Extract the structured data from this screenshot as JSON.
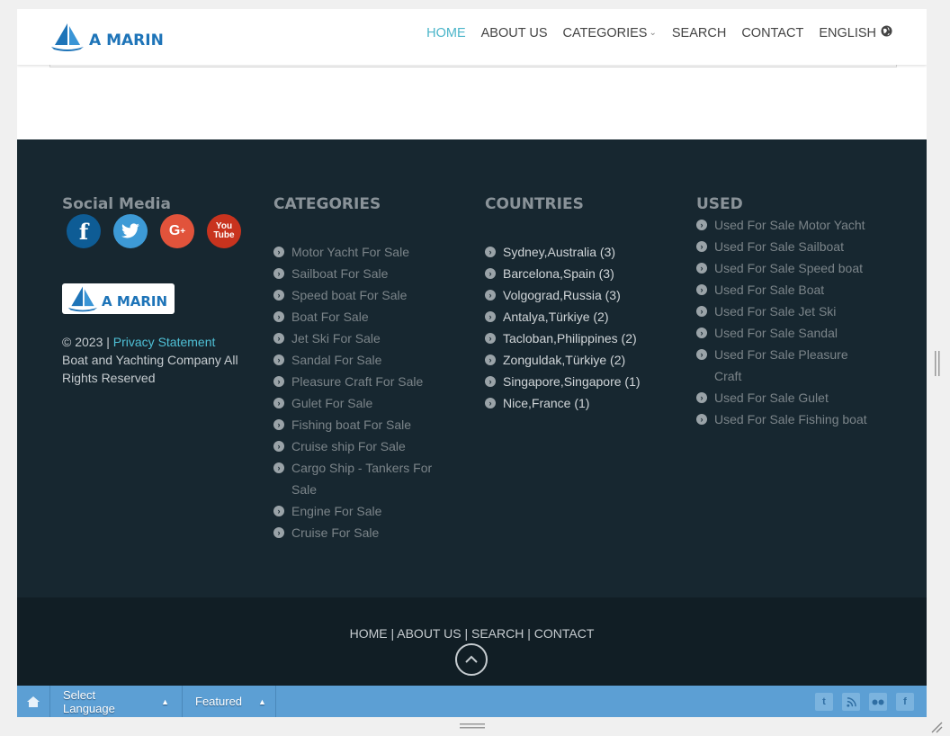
{
  "header": {
    "logo_text": "A MARIN",
    "nav": [
      "HOME",
      "ABOUT US",
      "CATEGORIES",
      "SEARCH",
      "CONTACT",
      "ENGLISH"
    ]
  },
  "footer": {
    "social": {
      "title": "Social Media",
      "icons": [
        "facebook-icon",
        "twitter-icon",
        "google-plus-icon",
        "youtube-icon"
      ]
    },
    "logo_text": "A MARIN",
    "copyright_prefix": "© 2023 |",
    "privacy_link": "Privacy Statement",
    "copyright_suffix": "Boat and Yachting Company All Rights Reserved",
    "categories": {
      "title": "CATEGORIES",
      "items": [
        "Motor Yacht For Sale",
        "Sailboat For Sale",
        "Speed boat For Sale",
        "Boat For Sale",
        "Jet Ski For Sale",
        "Sandal For Sale",
        "Pleasure Craft For Sale",
        "Gulet For Sale",
        "Fishing boat For Sale",
        "Cruise ship For Sale",
        "Cargo Ship - Tankers For Sale",
        "Engine For Sale",
        "Cruise For Sale"
      ]
    },
    "countries": {
      "title": "COUNTRIES",
      "items": [
        "Sydney,Australia (3)",
        "Barcelona,Spain (3)",
        "Volgograd,Russia (3)",
        "Antalya,Türkiye (2)",
        "Tacloban,Philippines (2)",
        "Zonguldak,Türkiye (2)",
        "Singapore,Singapore (1)",
        "Nice,France (1)"
      ]
    },
    "used": {
      "title": "USED",
      "items": [
        "Used For Sale Motor Yacht",
        "Used For Sale Sailboat",
        "Used For Sale Speed boat",
        "Used For Sale Boat",
        "Used For Sale Jet Ski",
        "Used For Sale Sandal",
        "Used For Sale Pleasure Craft",
        "Used For Sale Gulet",
        "Used For Sale Fishing boat"
      ]
    },
    "bottom_links": [
      "HOME",
      "ABOUT US",
      "SEARCH",
      "CONTACT"
    ],
    "separator": "|"
  },
  "toolbar": {
    "select_language": "Select Language",
    "featured": "Featured",
    "right_icons": [
      "twitter-icon",
      "rss-icon",
      "flickr-icon",
      "facebook-icon"
    ]
  }
}
